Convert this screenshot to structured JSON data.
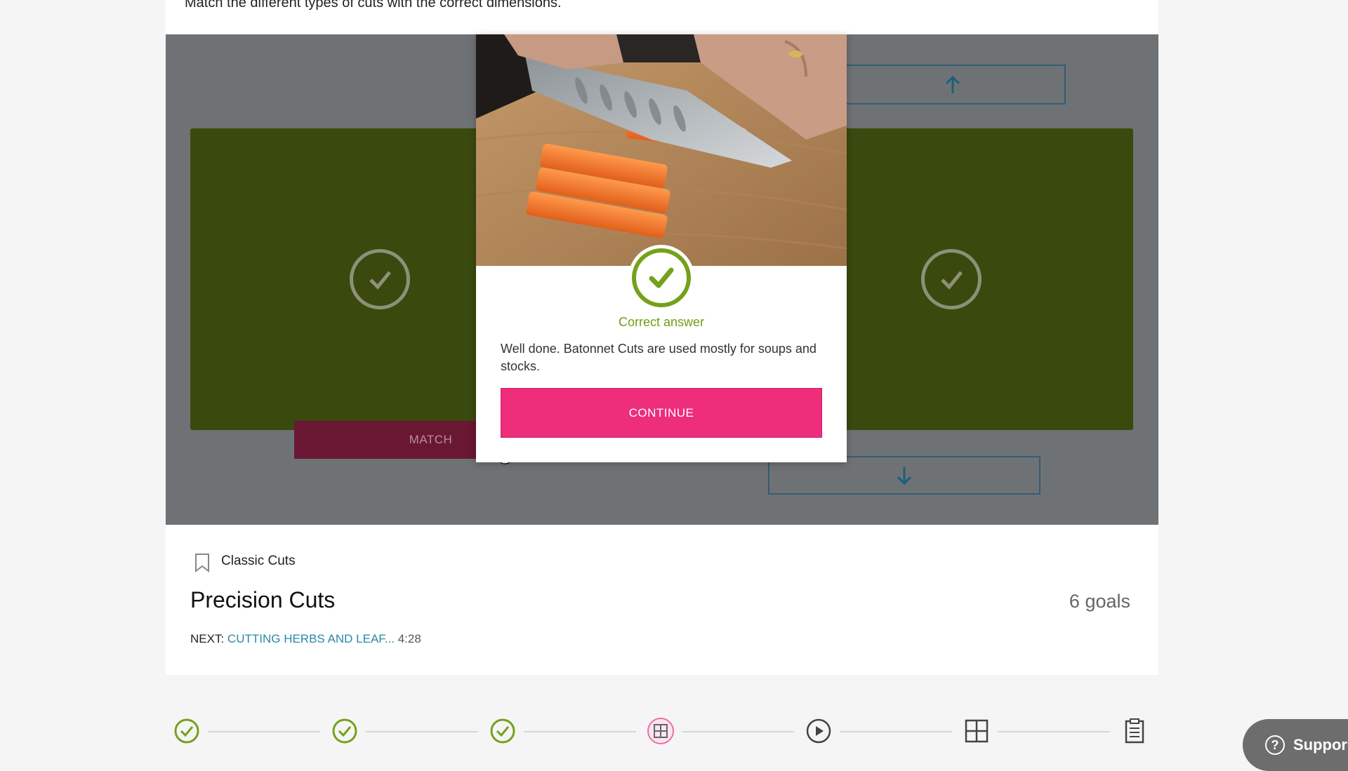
{
  "instructions": "Match the different types of cuts with the correct dimensions.",
  "activity": {
    "match_label": "MATCH"
  },
  "modal": {
    "status_label": "Correct answer",
    "feedback": "Well done. Batonnet Cuts are used mostly for soups and stocks.",
    "continue_label": "CONTINUE"
  },
  "lesson": {
    "category": "Classic Cuts",
    "title": "Precision Cuts",
    "goals": "6 goals",
    "next_prefix": "NEXT:",
    "next_link": "CUTTING HERBS AND LEAF...",
    "next_duration": "4:28"
  },
  "progress_steps": [
    {
      "icon": "check-circle-icon",
      "state": "completed"
    },
    {
      "icon": "check-circle-icon",
      "state": "completed"
    },
    {
      "icon": "check-circle-icon",
      "state": "completed"
    },
    {
      "icon": "activity-icon",
      "state": "current"
    },
    {
      "icon": "play-circle-icon",
      "state": "upcoming"
    },
    {
      "icon": "activity-icon",
      "state": "upcoming"
    },
    {
      "icon": "clipboard-icon",
      "state": "upcoming"
    }
  ],
  "support": {
    "label": "Suppor"
  },
  "colors": {
    "accent_pink": "#ee2d7b",
    "success_green": "#75a11a",
    "link_teal": "#2a8aa6",
    "panel_green": "#3a4a0e"
  }
}
